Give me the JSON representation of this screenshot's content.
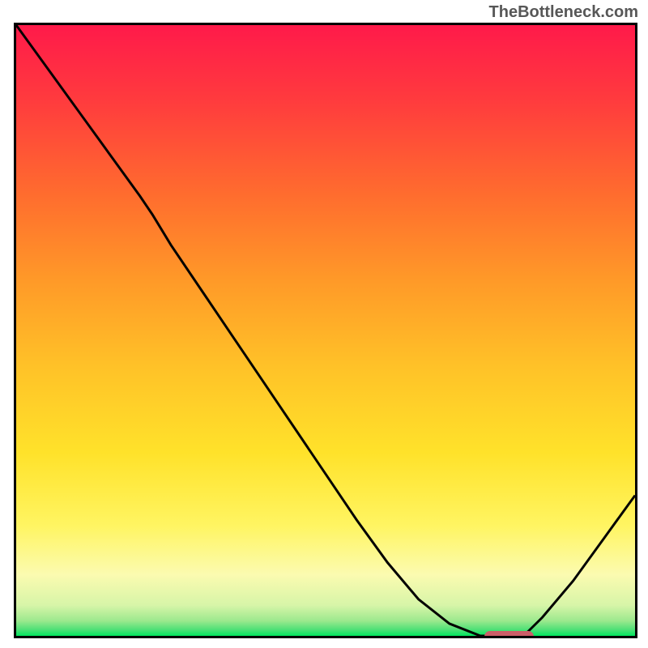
{
  "watermark": "TheBottleneck.com",
  "chart_data": {
    "type": "line",
    "title": "",
    "xlabel": "",
    "ylabel": "",
    "xlim": [
      0,
      100
    ],
    "ylim": [
      0,
      100
    ],
    "x": [
      0,
      5,
      10,
      15,
      20,
      22,
      25,
      30,
      35,
      40,
      45,
      50,
      55,
      60,
      65,
      70,
      75,
      78,
      82,
      85,
      90,
      95,
      100
    ],
    "values": [
      100,
      93,
      86,
      79,
      72,
      69,
      64,
      56.5,
      49,
      41.5,
      34,
      26.5,
      19,
      12,
      6,
      2,
      0,
      0,
      0,
      3,
      9,
      16,
      23
    ],
    "gradient_colors": {
      "top": "#ff1744",
      "upper_mid": "#ff9128",
      "mid": "#ffe82d",
      "lower_mid": "#faf98e",
      "bottom": "#00e65f"
    },
    "marker": {
      "x_start": 75,
      "x_end": 83,
      "y": 0,
      "color": "#cc5e68"
    }
  }
}
